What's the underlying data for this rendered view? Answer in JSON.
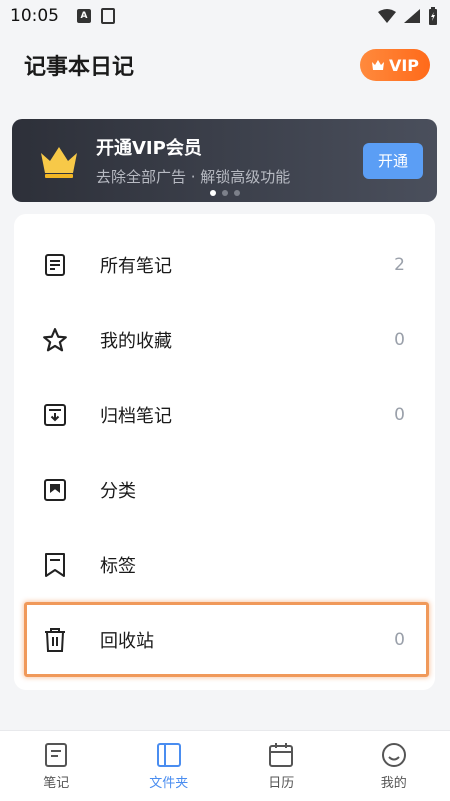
{
  "status": {
    "time": "10:05"
  },
  "header": {
    "title": "记事本日记",
    "vip_label": "VIP"
  },
  "banner": {
    "title": "开通VIP会员",
    "subtitle": "去除全部广告 · 解锁高级功能",
    "button": "开通"
  },
  "list": [
    {
      "label": "所有笔记",
      "count": "2",
      "icon": "note-icon"
    },
    {
      "label": "我的收藏",
      "count": "0",
      "icon": "star-icon"
    },
    {
      "label": "归档笔记",
      "count": "0",
      "icon": "archive-icon"
    },
    {
      "label": "分类",
      "count": "",
      "icon": "category-icon"
    },
    {
      "label": "标签",
      "count": "",
      "icon": "tag-icon"
    },
    {
      "label": "回收站",
      "count": "0",
      "icon": "trash-icon"
    }
  ],
  "nav": [
    {
      "label": "笔记",
      "icon": "note-icon"
    },
    {
      "label": "文件夹",
      "icon": "folder-icon",
      "active": true
    },
    {
      "label": "日历",
      "icon": "calendar-icon"
    },
    {
      "label": "我的",
      "icon": "smile-icon"
    }
  ],
  "colors": {
    "accent": "#4a8df0",
    "vip": "#ff7a2a",
    "banner_button": "#5b9ef5",
    "highlight": "#f0995a"
  }
}
